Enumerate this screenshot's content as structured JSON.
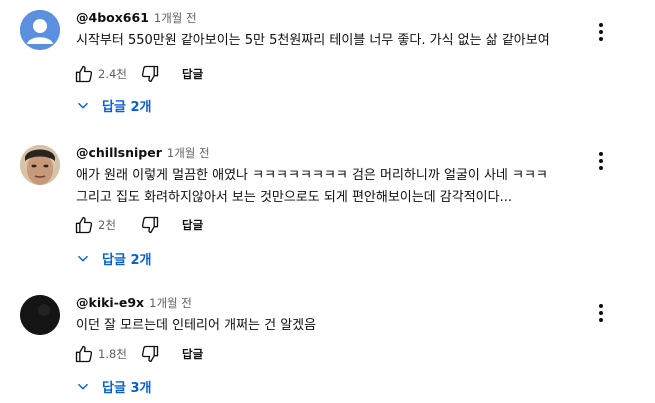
{
  "accent_color": "#065fd4",
  "comments": [
    {
      "handle": "@4box661",
      "time": "1개월 전",
      "lines": [
        "시작부터 550만원 같아보이는 5만 5천원짜리 테이블 너무 좋다. 가식 없는 삶 같아보여"
      ],
      "likes": "2.4천",
      "reply_label": "답글",
      "replies_label": "답글 2개",
      "avatar_icon": "default-user-avatar"
    },
    {
      "handle": "@chillsniper",
      "time": "1개월 전",
      "lines": [
        "애가 원래 이렇게 멀끔한 애였나 ㅋㅋㅋㅋㅋㅋㅋㅋ 검은 머리하니까 얼굴이 사네 ㅋㅋㅋ",
        "그리고 집도 화려하지않아서 보는 것만으로도 되게 편안해보이는데 감각적이다..."
      ],
      "likes": "2천",
      "reply_label": "답글",
      "replies_label": "답글 2개",
      "avatar_icon": "photo-avatar"
    },
    {
      "handle": "@kiki-e9x",
      "time": "1개월 전",
      "lines": [
        "이던 잘 모르는데 인테리어 개쩌는 건 알겠음"
      ],
      "likes": "1.8천",
      "reply_label": "답글",
      "replies_label": "답글 3개",
      "avatar_icon": "dark-avatar"
    }
  ]
}
